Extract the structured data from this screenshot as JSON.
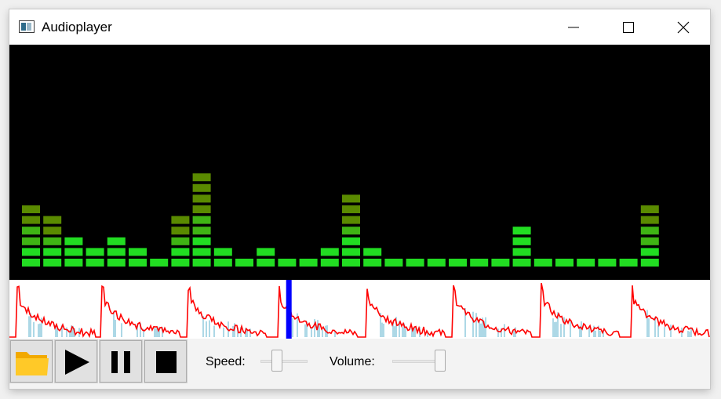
{
  "window": {
    "title": "Audioplayer",
    "icon": "audio-app-icon",
    "controls": [
      "minimize-icon",
      "maximize-icon",
      "close-icon"
    ]
  },
  "spectrum": {
    "bar_color": "#22dd22",
    "top_color": "#5a8a00",
    "background": "#000000",
    "levels": [
      6,
      5,
      3,
      2,
      3,
      2,
      1,
      5,
      9,
      2,
      1,
      2,
      1,
      1,
      2,
      7,
      2,
      1,
      1,
      1,
      1,
      1,
      1,
      4,
      1,
      1,
      1,
      1,
      1,
      6
    ]
  },
  "waveform": {
    "playhead_position": 0.395,
    "envelope_color": "#ff0000",
    "fill_color": "#add8e6",
    "playhead_color": "#0000ff"
  },
  "controls": {
    "open_icon": "folder-icon",
    "play_icon": "play-icon",
    "pause_icon": "pause-icon",
    "stop_icon": "stop-icon",
    "speed_label": "Speed:",
    "speed_value": 0.3,
    "volume_label": "Volume:",
    "volume_value": 1.0
  }
}
